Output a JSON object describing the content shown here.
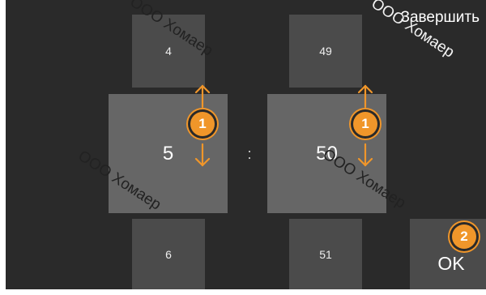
{
  "header": {
    "finish_label": "Завершить"
  },
  "picker": {
    "hours": {
      "prev": "4",
      "current": "5",
      "next": "6"
    },
    "separator": ":",
    "minutes": {
      "prev": "49",
      "current": "50",
      "next": "51"
    }
  },
  "ok_label": "OK",
  "badges": {
    "hours_step": "1",
    "minutes_step": "1",
    "ok_step": "2"
  },
  "watermark": "ООО Хомаер",
  "colors": {
    "accent": "#f0962a",
    "background": "#2a2a2a",
    "tile": "#4b4b4b",
    "tile_active": "#666666"
  }
}
